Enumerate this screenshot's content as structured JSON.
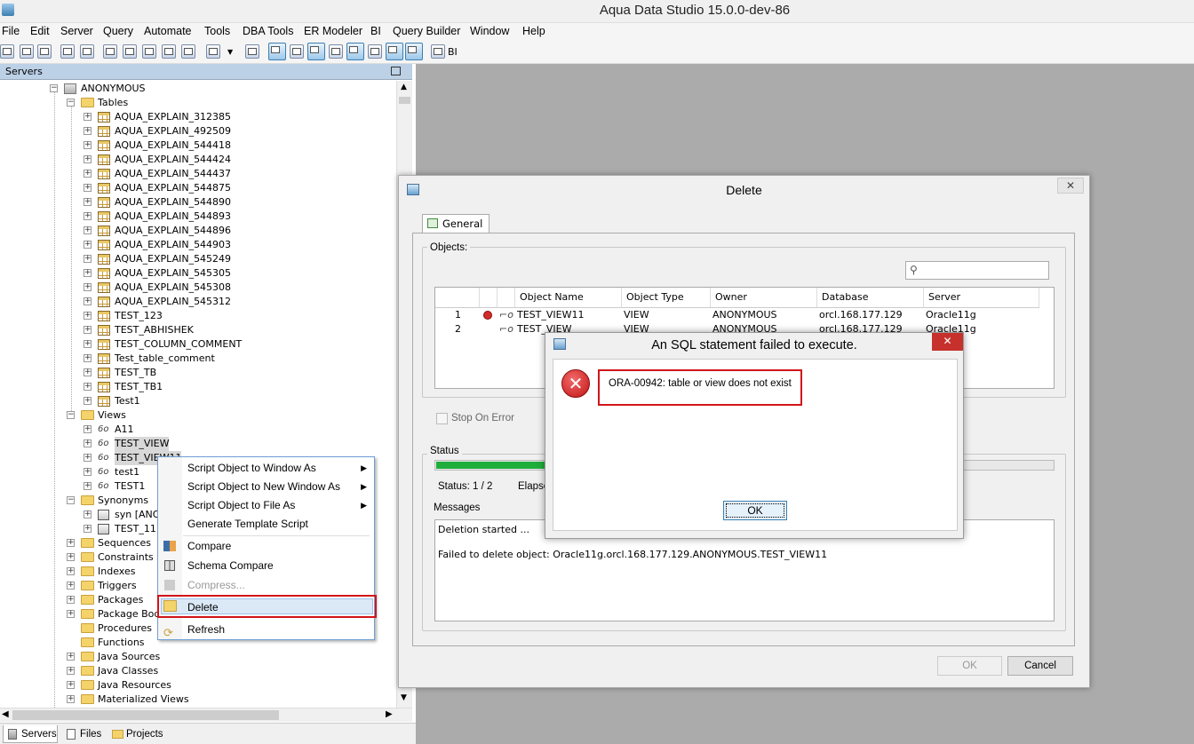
{
  "app": {
    "title": "Aqua Data Studio 15.0.0-dev-86",
    "menu": [
      "File",
      "Edit",
      "Server",
      "Query",
      "Automate",
      "Tools",
      "DBA Tools",
      "ER Modeler",
      "BI",
      "Query Builder",
      "Window",
      "Help"
    ],
    "toolbar_bi_label": "BI"
  },
  "servers_panel": {
    "title": "Servers",
    "tree": {
      "schema": "ANONYMOUS",
      "tables_folder": "Tables",
      "tables": [
        "AQUA_EXPLAIN_312385",
        "AQUA_EXPLAIN_492509",
        "AQUA_EXPLAIN_544418",
        "AQUA_EXPLAIN_544424",
        "AQUA_EXPLAIN_544437",
        "AQUA_EXPLAIN_544875",
        "AQUA_EXPLAIN_544890",
        "AQUA_EXPLAIN_544893",
        "AQUA_EXPLAIN_544896",
        "AQUA_EXPLAIN_544903",
        "AQUA_EXPLAIN_545249",
        "AQUA_EXPLAIN_545305",
        "AQUA_EXPLAIN_545308",
        "AQUA_EXPLAIN_545312",
        "TEST_123",
        "TEST_ABHISHEK",
        "TEST_COLUMN_COMMENT",
        "Test_table_comment",
        "TEST_TB",
        "TEST_TB1",
        "Test1"
      ],
      "views_folder": "Views",
      "views": [
        "A11",
        "TEST_VIEW",
        "TEST_VIEW11",
        "test1",
        "TEST1"
      ],
      "synonyms_folder": "Synonyms",
      "synonyms": [
        "syn [ANO",
        "TEST_11 ["
      ],
      "folders": [
        "Sequences",
        "Constraints",
        "Indexes",
        "Triggers",
        "Packages",
        "Package Bodie",
        "Procedures",
        "Functions",
        "Java Sources",
        "Java Classes",
        "Java Resources",
        "Materialized Views"
      ]
    },
    "bottom_tabs": [
      "Servers",
      "Files",
      "Projects"
    ]
  },
  "context_menu": {
    "items": [
      {
        "label": "Script Object to Window As",
        "submenu": true
      },
      {
        "label": "Script Object to New Window As",
        "submenu": true
      },
      {
        "label": "Script Object to File As",
        "submenu": true
      },
      {
        "label": "Generate Template Script",
        "submenu": false
      },
      {
        "label": "Compare",
        "submenu": false
      },
      {
        "label": "Schema Compare",
        "submenu": false
      },
      {
        "label": "Compress...",
        "submenu": false,
        "disabled": true
      },
      {
        "label": "Delete",
        "submenu": false,
        "highlighted": true
      },
      {
        "label": "Refresh",
        "submenu": false
      }
    ],
    "submenu_arrow": "▶"
  },
  "delete_dialog": {
    "title": "Delete",
    "tab": "General",
    "objects_label": "Objects:",
    "columns": [
      "Object Name",
      "Object Type",
      "Owner",
      "Database",
      "Server"
    ],
    "rows": [
      {
        "num": "1",
        "name": "TEST_VIEW11",
        "type": "VIEW",
        "owner": "ANONYMOUS",
        "database": "orcl.168.177.129",
        "server": "Oracle11g",
        "error": true
      },
      {
        "num": "2",
        "name": "TEST_VIEW",
        "type": "VIEW",
        "owner": "ANONYMOUS",
        "database": "orcl.168.177.129",
        "server": "Oracle11g",
        "error": false
      }
    ],
    "stop_on_error": "Stop On Error",
    "status_label": "Status",
    "status_text": "Status:  1 / 2",
    "elapsed_text": "Elapse",
    "progress": 0.25,
    "messages_label": "Messages",
    "messages": [
      "Deletion started ...",
      "Failed to delete object: Oracle11g.orcl.168.177.129.ANONYMOUS.TEST_VIEW11"
    ],
    "ok": "OK",
    "cancel": "Cancel"
  },
  "error_dialog": {
    "title": "An SQL statement failed to execute.",
    "message": "ORA-00942: table or view does not exist",
    "ok": "OK"
  },
  "colors": {
    "highlight_red": "#d1151a",
    "progress_green": "#1fae3b",
    "panel_header": "#bcd0e6"
  }
}
